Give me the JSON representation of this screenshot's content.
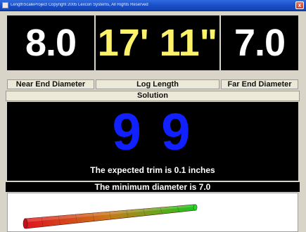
{
  "window": {
    "title": "LengthScaleProject Copyright 2005 Lexcon Systems, All Rights Reserved",
    "close_label": "x"
  },
  "measurements": {
    "near_end_diameter": {
      "value": "8.0",
      "label": "Near End Diameter"
    },
    "log_length": {
      "value": "17' 11\"",
      "label": "Log Length"
    },
    "far_end_diameter": {
      "value": "7.0",
      "label": "Far End Diameter"
    }
  },
  "solution": {
    "header": "Solution",
    "value": "9 9",
    "trim_text": "The expected trim is 0.1 inches",
    "min_diameter_text": "The minimum diameter is 7.0"
  },
  "log_visual": {
    "colors": {
      "near_end": "#e0141e",
      "mid": "#c87a1a",
      "far_end": "#18c81e"
    },
    "segments": 10
  }
}
